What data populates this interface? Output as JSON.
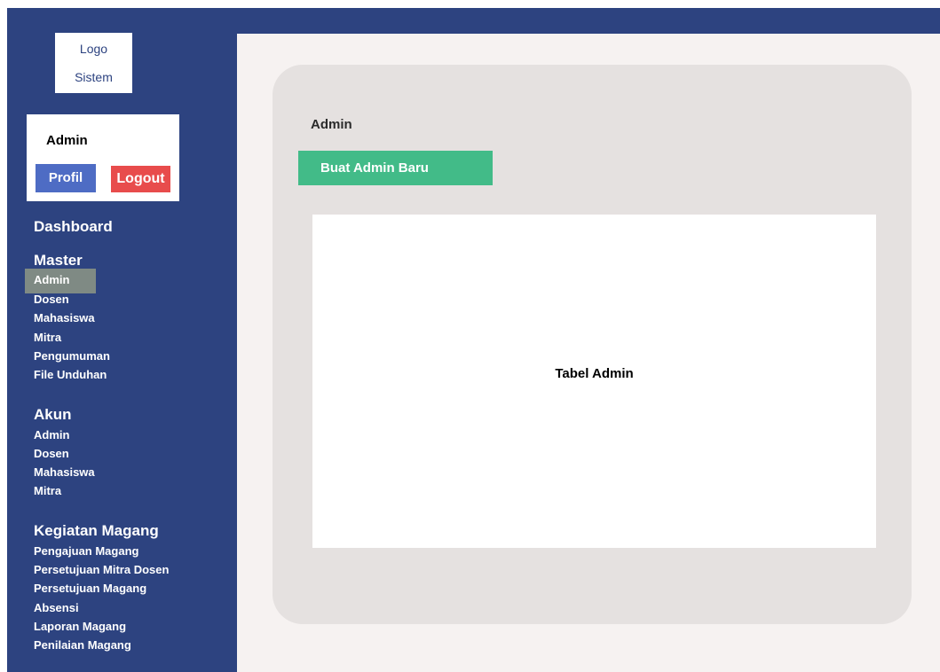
{
  "logo": {
    "line1": "Logo",
    "line2": "Sistem"
  },
  "user": {
    "name": "Admin",
    "profil_label": "Profil",
    "logout_label": "Logout"
  },
  "nav": {
    "dashboard": "Dashboard",
    "master": {
      "heading": "Master",
      "items": [
        "Admin",
        "Dosen",
        "Mahasiswa",
        "Mitra",
        "Pengumuman",
        "File Unduhan"
      ],
      "active": "Admin"
    },
    "akun": {
      "heading": "Akun",
      "items": [
        "Admin",
        "Dosen",
        "Mahasiswa",
        "Mitra"
      ]
    },
    "kegiatan": {
      "heading": "Kegiatan Magang",
      "items": [
        "Pengajuan Magang",
        "Persetujuan Mitra Dosen",
        "Persetujuan Magang",
        "Absensi",
        "Laporan Magang",
        "Penilaian Magang"
      ]
    }
  },
  "main": {
    "title": "Admin",
    "create_button": "Buat Admin Baru",
    "table_placeholder": "Tabel Admin"
  },
  "colors": {
    "sidebar": "#2d4380",
    "background": "#f6f2f1",
    "card": "#e5e1e0",
    "profil_button": "#4e6cc4",
    "logout_button": "#e84c4c",
    "create_button": "#42bb88",
    "active_item": "#7f8a84"
  }
}
